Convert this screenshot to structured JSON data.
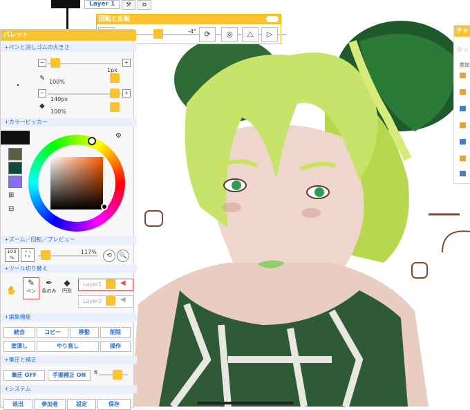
{
  "top": {
    "layer_label": "Layer 1"
  },
  "rotate_panel": {
    "title": "回転と反転",
    "angle": "-4°"
  },
  "palette": {
    "title": "パレット",
    "sections": {
      "pen_size": "+ペンと消しゴムの大きさ",
      "color_picker": "+カラーピッカー",
      "zoom": "+ズーム／回転／プレビュー",
      "tool_switch": "+ツール切り替え",
      "edit": "+編集機能",
      "pressure": "+筆圧と補正",
      "system": "+システム"
    },
    "pen": {
      "size": "1px",
      "opacity": "100%"
    },
    "eraser": {
      "size": "140px",
      "opacity": "100%"
    },
    "zoom_value": "117%",
    "zoom_100": "100",
    "tools": {
      "pen": "ペン",
      "eyedropper": "色のみ",
      "eraser": "円形"
    },
    "layers": [
      "Layer1",
      "Layer2"
    ],
    "edit_buttons": [
      "統合",
      "コピー",
      "移動",
      "削除",
      "塗潰し",
      "やり直し",
      "操作"
    ],
    "pressure": {
      "pressure_btn": "筆圧 OFF",
      "stabilizer_btn": "手振補正 ON",
      "stabilizer_value": "6"
    },
    "system_buttons": [
      "退出",
      "参加者",
      "設定",
      "保存"
    ],
    "colors": {
      "brand": "#f7c330",
      "swatch1": "#5a5f45",
      "swatch2": "#0e4a40",
      "swatch3": "#8a6df0"
    }
  },
  "chat": {
    "title": "チャ",
    "input_placeholder": "タッ",
    "tab": "参加"
  }
}
